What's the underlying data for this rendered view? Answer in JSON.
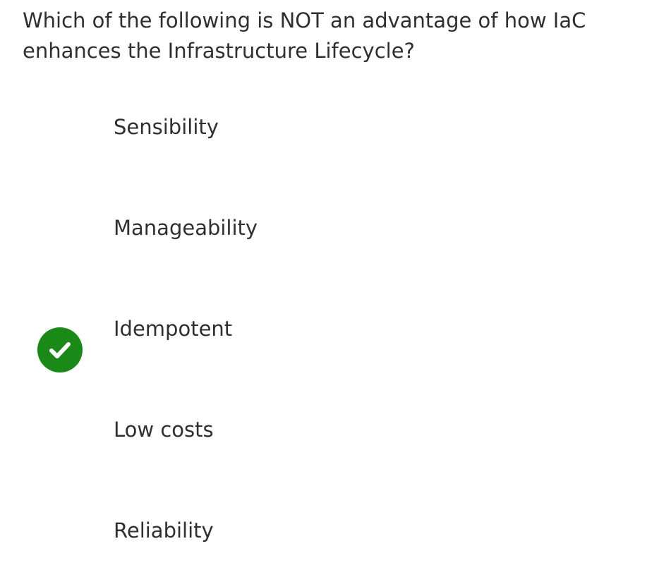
{
  "question": {
    "text": "Which of the following is NOT an advantage of how IaC enhances the Infrastructure Lifecycle?"
  },
  "options": [
    {
      "label": "Sensibility",
      "correct": false
    },
    {
      "label": "Manageability",
      "correct": false
    },
    {
      "label": "Idempotent",
      "correct": false
    },
    {
      "label": "Low costs",
      "correct": true
    },
    {
      "label": "Reliability",
      "correct": false
    }
  ],
  "icons": {
    "correct_marker": "check-circle-icon"
  },
  "colors": {
    "correct_marker": "#1a8917",
    "text": "#2d2f31"
  }
}
